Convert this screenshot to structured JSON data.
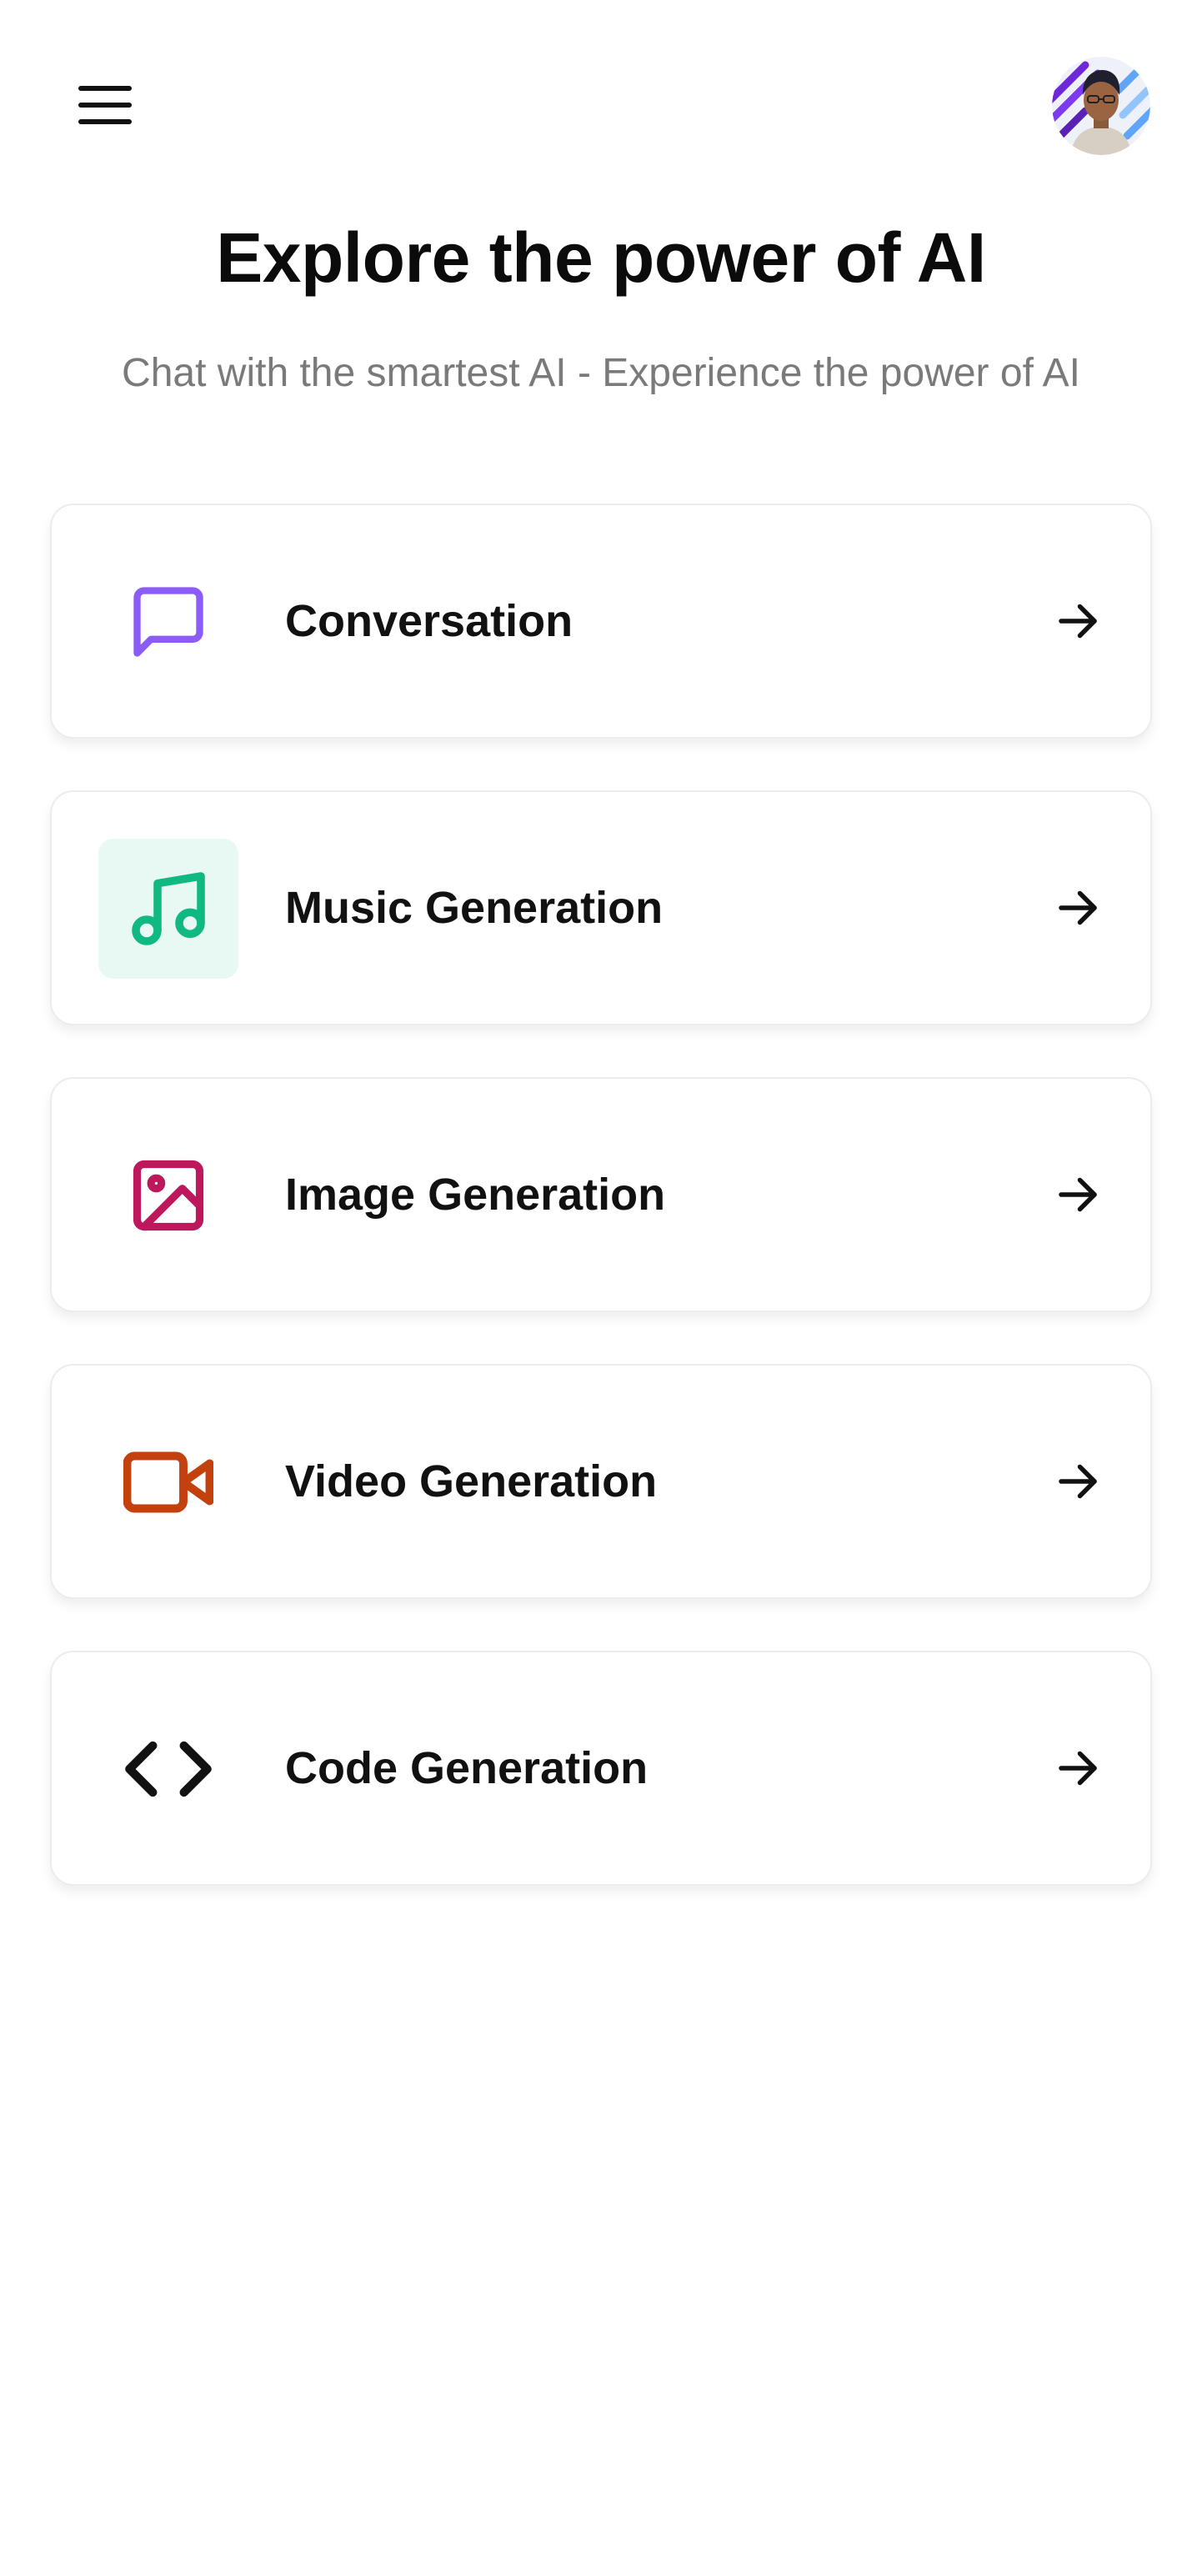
{
  "header": {
    "menu_icon": "hamburger-menu-icon",
    "avatar": "user-avatar"
  },
  "hero": {
    "title": "Explore the power of AI",
    "subtitle": "Chat with the smartest AI - Experience the power of AI"
  },
  "tools": [
    {
      "label": "Conversation",
      "icon": "message-square-icon",
      "color": "#8b5cf6",
      "bg": "#ffffff"
    },
    {
      "label": "Music Generation",
      "icon": "music-note-icon",
      "color": "#10b981",
      "bg": "#e8f8f2"
    },
    {
      "label": "Image Generation",
      "icon": "image-icon",
      "color": "#be185d",
      "bg": "#ffffff"
    },
    {
      "label": "Video Generation",
      "icon": "video-camera-icon",
      "color": "#c2410c",
      "bg": "#ffffff"
    },
    {
      "label": "Code Generation",
      "icon": "code-icon",
      "color": "#111111",
      "bg": "#ffffff"
    }
  ],
  "arrow_icon": "arrow-right-icon"
}
